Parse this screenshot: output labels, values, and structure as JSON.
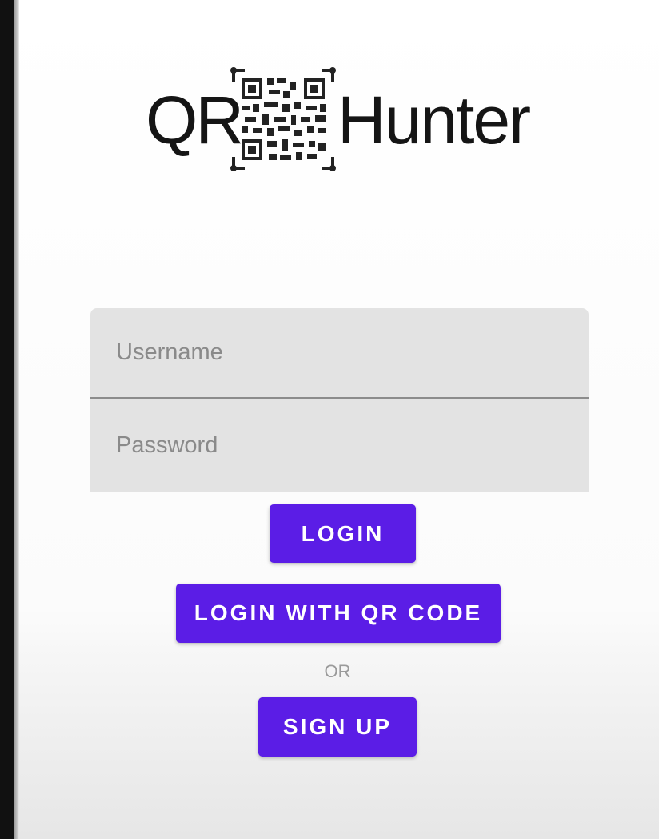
{
  "app": {
    "logo_left": "QR",
    "logo_right": "Hunter",
    "logo_icon": "qr-code-icon"
  },
  "form": {
    "username_placeholder": "Username",
    "password_placeholder": "Password"
  },
  "buttons": {
    "login": "LOGIN",
    "login_qr": "LOGIN WITH QR CODE",
    "or": "OR",
    "signup": "SIGN UP"
  },
  "colors": {
    "accent": "#5b1de6",
    "field_bg": "#e3e3e3",
    "text_dark": "#151515"
  }
}
